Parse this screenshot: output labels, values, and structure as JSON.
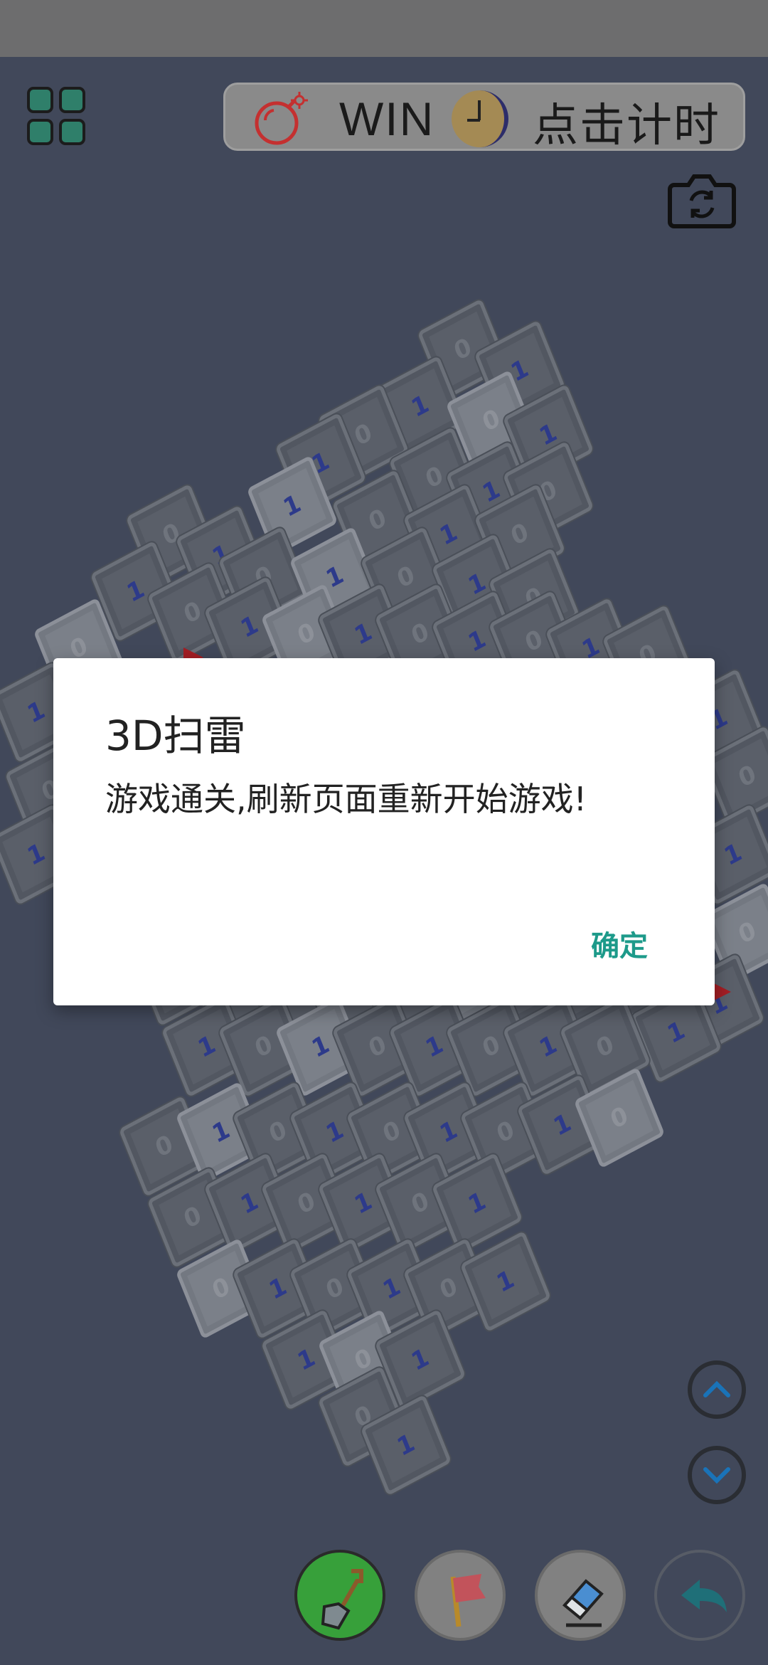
{
  "toolbar": {
    "status_text": "WIN",
    "timer_text": "点击计时"
  },
  "dialog": {
    "title": "3D扫雷",
    "message": "游戏通关,刷新页面重新开始游戏!",
    "ok_label": "确定"
  },
  "cube_digits": {
    "zero": "0",
    "one": "1"
  },
  "icons": {
    "menu": "grid-menu-icon",
    "bomb": "bomb-icon",
    "clock": "clock-icon",
    "camera": "camera-reset-icon",
    "up": "chevron-up-icon",
    "down": "chevron-down-icon",
    "dig": "shovel-icon",
    "flag": "flag-icon",
    "erase": "eraser-icon",
    "undo": "undo-arrow-icon"
  },
  "colors": {
    "accent": "#1d9a8a",
    "dig_active": "#37a03a",
    "scene_bg": "#41485a"
  }
}
